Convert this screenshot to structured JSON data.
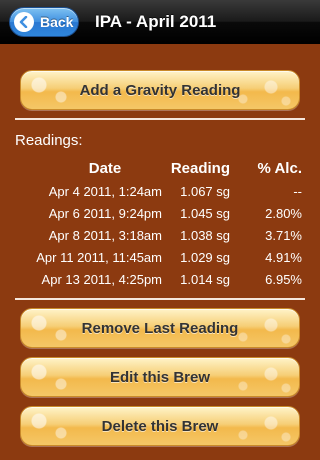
{
  "navbar": {
    "back_label": "Back",
    "title": "IPA - April 2011"
  },
  "actions": {
    "add_gravity": "Add a Gravity Reading",
    "remove_last": "Remove Last Reading",
    "edit_brew": "Edit this Brew",
    "delete_brew": "Delete this Brew"
  },
  "readings": {
    "label": "Readings:",
    "headers": [
      "Date",
      "Reading",
      "% Alc."
    ],
    "rows": [
      [
        "Apr 4 2011, 1:24am",
        "1.067 sg",
        "--"
      ],
      [
        "Apr 6 2011, 9:24pm",
        "1.045 sg",
        "2.80%"
      ],
      [
        "Apr 8 2011, 3:18am",
        "1.038 sg",
        "3.71%"
      ],
      [
        "Apr 11 2011, 11:45am",
        "1.029 sg",
        "4.91%"
      ],
      [
        "Apr 13 2011, 4:25pm",
        "1.014 sg",
        "6.95%"
      ]
    ]
  },
  "colors": {
    "background": "#8c3a10",
    "button_fill": "#f6cf77",
    "back_button": "#3f8fe0"
  },
  "icons": {
    "back": "chevron-left-icon"
  }
}
